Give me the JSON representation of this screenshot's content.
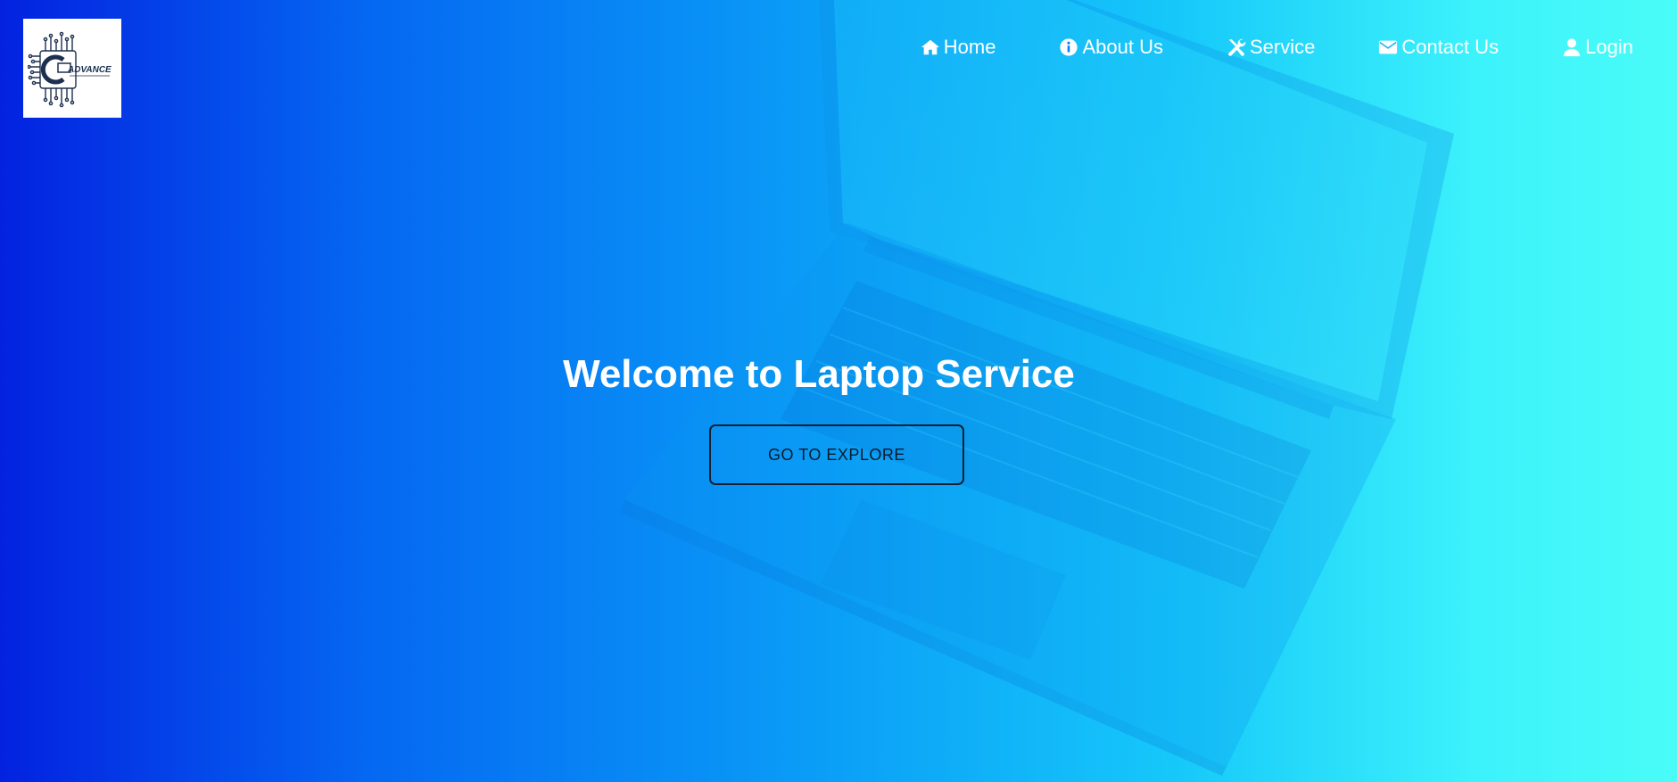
{
  "brand": {
    "logo_text": "ADVANCE",
    "logo_icon": "circuit-laptop-logo"
  },
  "nav": {
    "items": [
      {
        "label": "Home",
        "icon": "home-icon"
      },
      {
        "label": "About Us",
        "icon": "info-icon"
      },
      {
        "label": "Service",
        "icon": "tools-icon"
      },
      {
        "label": "Contact Us",
        "icon": "envelope-icon"
      },
      {
        "label": "Login",
        "icon": "user-icon"
      }
    ]
  },
  "hero": {
    "title": "Welcome to Laptop Service",
    "cta_label": "GO TO EXPLORE",
    "background_image": "laptop-photo"
  },
  "colors": {
    "gradient_start": "#0322e0",
    "gradient_mid": "#0a9cf7",
    "gradient_end": "#4afcf8",
    "nav_text": "#ffffff",
    "title_text": "#ffffff",
    "button_border": "#102030"
  }
}
